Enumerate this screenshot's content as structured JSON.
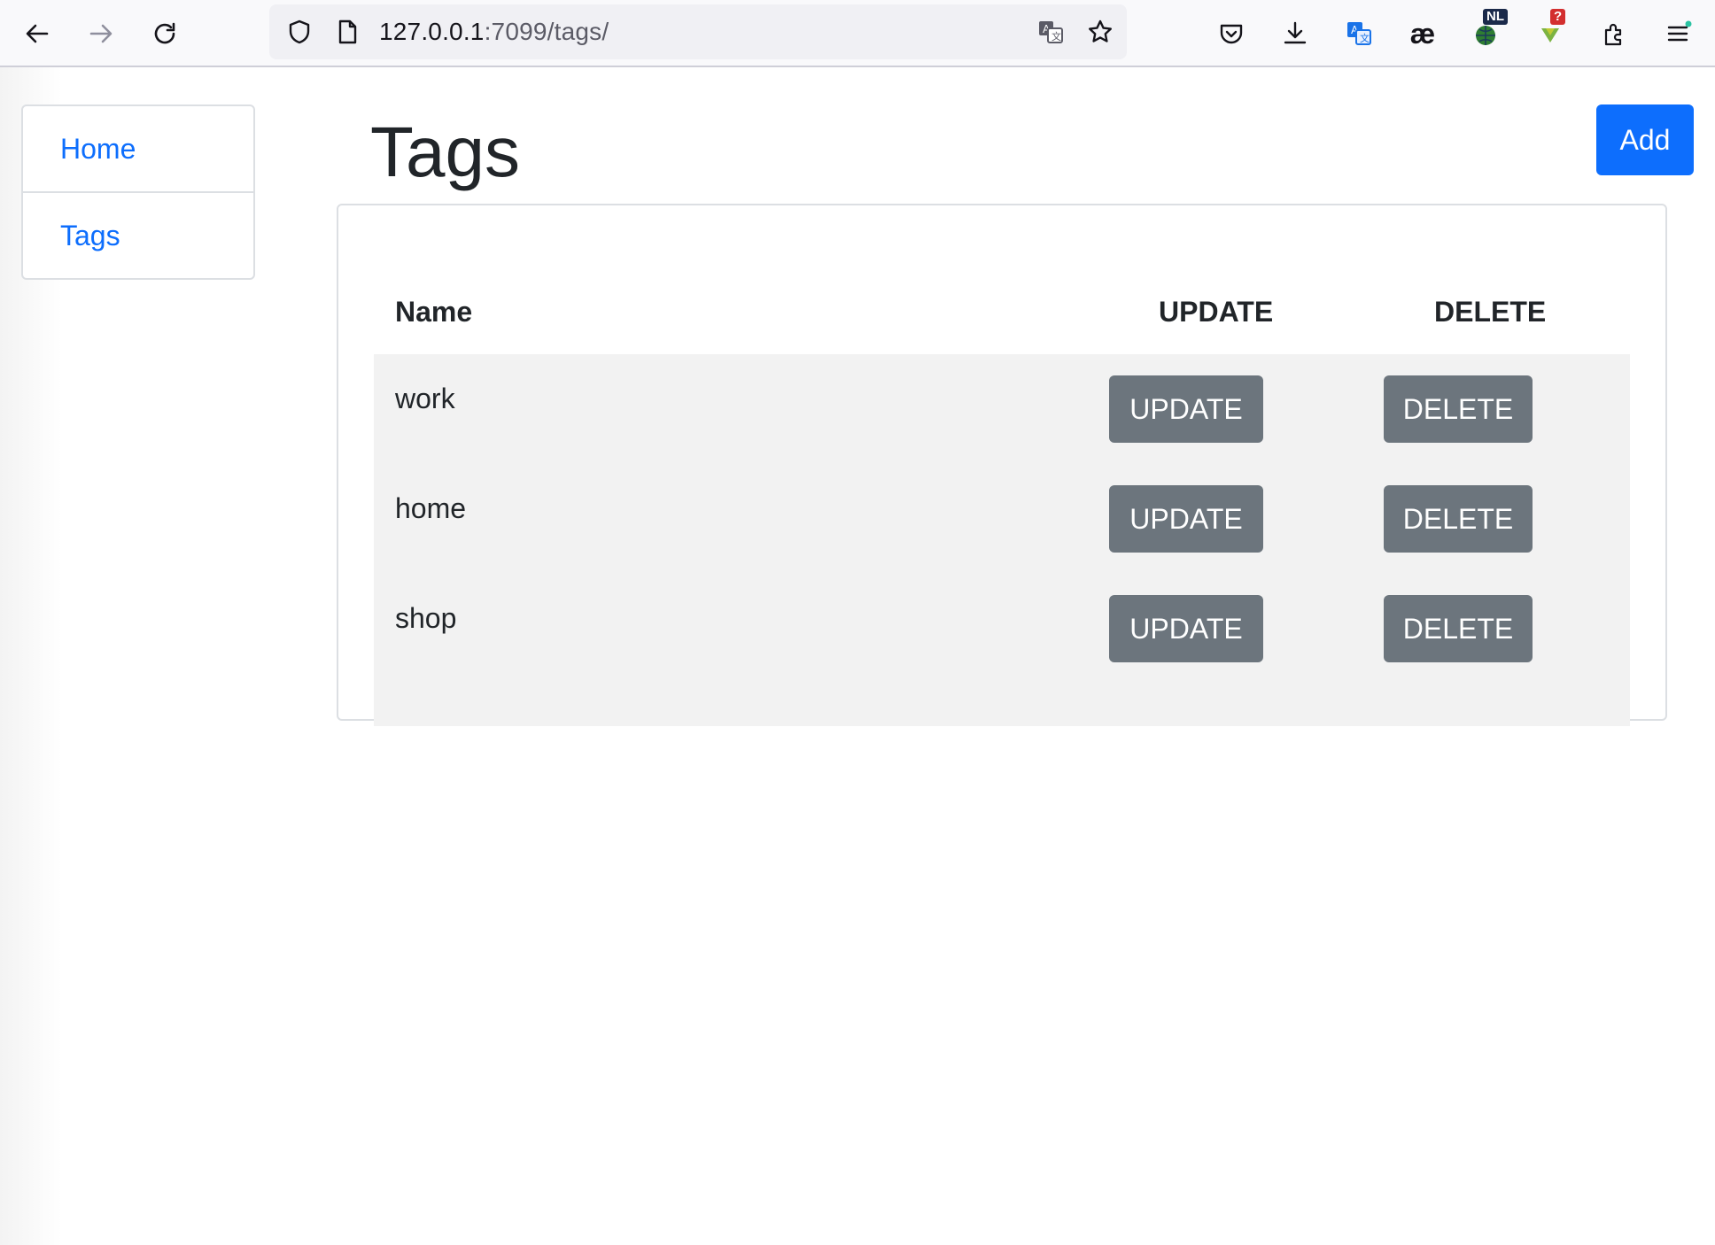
{
  "browser": {
    "url_host": "127.0.0.1",
    "url_path": ":7099/tags/",
    "extensions": {
      "nl_badge": "NL",
      "alert_badge": "?",
      "ae_label": "æ"
    }
  },
  "sidebar": {
    "items": [
      {
        "label": "Home"
      },
      {
        "label": "Tags"
      }
    ]
  },
  "page": {
    "title": "Tags",
    "add_label": "Add"
  },
  "table": {
    "headers": {
      "name": "Name",
      "update": "UPDATE",
      "delete": "DELETE"
    },
    "rows": [
      {
        "name": "work",
        "update_label": "UPDATE",
        "delete_label": "DELETE"
      },
      {
        "name": "home",
        "update_label": "UPDATE",
        "delete_label": "DELETE"
      },
      {
        "name": "shop",
        "update_label": "UPDATE",
        "delete_label": "DELETE"
      }
    ]
  },
  "colors": {
    "primary": "#0d6efd",
    "secondary": "#6c757d",
    "row_background": "#f2f2f2"
  }
}
